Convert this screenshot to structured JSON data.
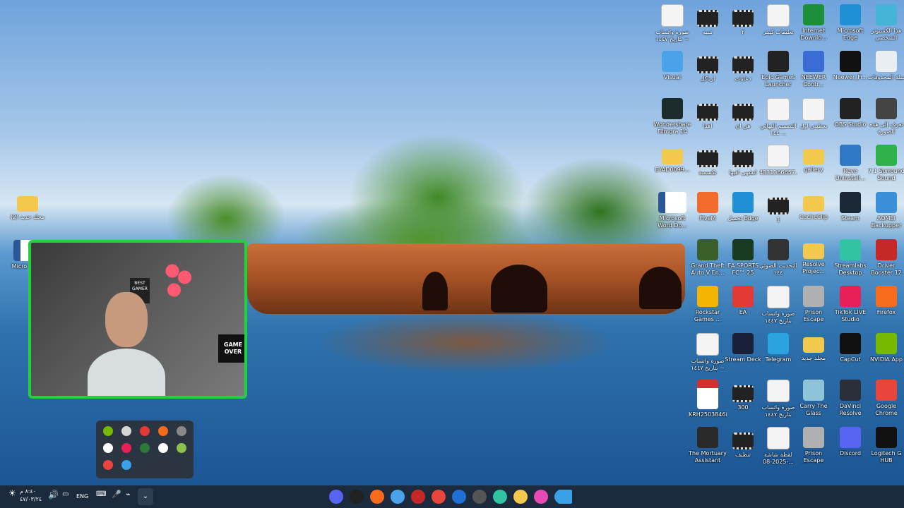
{
  "desktop": {
    "icons": [
      {
        "label": "صورة واتساب بتاريخ ١٤٤٧ ~",
        "kind": "doc",
        "color": "#f4f4f4"
      },
      {
        "label": "تنبيه",
        "kind": "video",
        "color": "#222"
      },
      {
        "label": "٢",
        "kind": "video",
        "color": "#222"
      },
      {
        "label": "تعليقات كيبتر",
        "kind": "doc",
        "color": "#f4f4f4"
      },
      {
        "label": "Internet Downlo...",
        "kind": "app",
        "color": "#1c8f3a"
      },
      {
        "label": "Microsoft Edge",
        "kind": "app",
        "color": "#1f8fd6"
      },
      {
        "label": "هذا الكمبيوتر الشخصي",
        "kind": "app",
        "color": "#44b5d6"
      },
      {
        "label": "Visual",
        "kind": "app",
        "color": "#4aa3e8"
      },
      {
        "label": "ارباكل",
        "kind": "video",
        "color": "#222"
      },
      {
        "label": "دعايات",
        "kind": "video",
        "color": "#222"
      },
      {
        "label": "Epic Games Launcher",
        "kind": "app",
        "color": "#222"
      },
      {
        "label": "NEEWER Contr...",
        "kind": "app",
        "color": "#3a6cd6"
      },
      {
        "label": "Neewer_Fi...",
        "kind": "app",
        "color": "#111"
      },
      {
        "label": "سلة المحذوفات",
        "kind": "app",
        "color": "#e8eef2"
      },
      {
        "label": "Wondershare Filmora 14",
        "kind": "app",
        "color": "#1c2b2b"
      },
      {
        "label": "اهدا",
        "kind": "video",
        "color": "#222"
      },
      {
        "label": "هن ان",
        "kind": "video",
        "color": "#222"
      },
      {
        "label": "التصميم النهائي ١٤٤ ...",
        "kind": "doc",
        "color": "#f4f4f4"
      },
      {
        "label": "بعطيني اول",
        "kind": "doc",
        "color": "#e0e0e0"
      },
      {
        "label": "OBS Studio",
        "kind": "app",
        "color": "#222"
      },
      {
        "label": "تعرف إلى هذه الصورة",
        "kind": "app",
        "color": "#444"
      },
      {
        "label": "EYAD0099...",
        "kind": "folder",
        "color": "#f2c94c"
      },
      {
        "label": "تكسسة",
        "kind": "video",
        "color": "#222"
      },
      {
        "label": "اتشهي افيها",
        "kind": "video",
        "color": "#222"
      },
      {
        "label": "4331366657...",
        "kind": "doc",
        "color": "#9bd06a"
      },
      {
        "label": "gallery",
        "kind": "folder",
        "color": "#f2c94c"
      },
      {
        "label": "Revo Uninstall...",
        "kind": "app",
        "color": "#2f79c7"
      },
      {
        "label": "7.1 Surround Sound",
        "kind": "app",
        "color": "#2fb24a"
      },
      {
        "label": "Microsoft Word Do...",
        "kind": "word",
        "color": "#2b5797"
      },
      {
        "label": "FiveM",
        "kind": "app",
        "color": "#f26b2a"
      },
      {
        "label": "تحميل Edge",
        "kind": "app",
        "color": "#1f8fd6"
      },
      {
        "label": "1",
        "kind": "video",
        "color": "#222"
      },
      {
        "label": "CacheClip",
        "kind": "folder",
        "color": "#f2c94c"
      },
      {
        "label": "Steam",
        "kind": "app",
        "color": "#1b2838"
      },
      {
        "label": "AOMEI Backupper",
        "kind": "app",
        "color": "#3a8fd8"
      },
      {
        "label": "Grand Theft Auto V En...",
        "kind": "app",
        "color": "#3b5f2a"
      },
      {
        "label": "EA SPORTS FC™ 25",
        "kind": "app",
        "color": "#173a20"
      },
      {
        "label": "التحديث الضوئي ١٤٤",
        "kind": "app",
        "color": "#333"
      },
      {
        "label": "Resolve Projec...",
        "kind": "folder",
        "color": "#f2c94c"
      },
      {
        "label": "Streamlabs Desktop",
        "kind": "app",
        "color": "#31c3a2"
      },
      {
        "label": "Driver Booster 12",
        "kind": "app",
        "color": "#c62828"
      },
      {
        "label": "Rockstar Games ...",
        "kind": "app",
        "color": "#f4b400"
      },
      {
        "label": "EA",
        "kind": "app",
        "color": "#e53935"
      },
      {
        "label": "صورة واتساب بتاريخ ١٤٤٧",
        "kind": "doc",
        "color": "#444"
      },
      {
        "label": "Prison Escape Simulator D...",
        "kind": "app",
        "color": "#b0b0b0"
      },
      {
        "label": "TikTok LIVE Studio",
        "kind": "app",
        "color": "#e8205a"
      },
      {
        "label": "Firefox",
        "kind": "app",
        "color": "#f76b1c"
      },
      {
        "label": "صورة واتساب بتاريخ ١٤٤٧ ~",
        "kind": "doc",
        "color": "#e8eef2"
      },
      {
        "label": "Stream Deck",
        "kind": "app",
        "color": "#1a1f3a"
      },
      {
        "label": "Telegram",
        "kind": "app",
        "color": "#2aa3df"
      },
      {
        "label": "مجلد جديد",
        "kind": "folder",
        "color": "#f2c94c"
      },
      {
        "label": "CapCut",
        "kind": "app",
        "color": "#111"
      },
      {
        "label": "NVIDIA App",
        "kind": "app",
        "color": "#76b900"
      },
      {
        "label": "KRH25038468",
        "kind": "pdf",
        "color": "#d32f2f"
      },
      {
        "label": "300",
        "kind": "video",
        "color": "#222"
      },
      {
        "label": "صورة واتساب بتاريخ ١٤٤٧",
        "kind": "doc",
        "color": "#444"
      },
      {
        "label": "Carry The Glass",
        "kind": "app",
        "color": "#8fc3d8"
      },
      {
        "label": "DaVinci Resolve",
        "kind": "app",
        "color": "#2a2f38"
      },
      {
        "label": "Google Chrome",
        "kind": "app",
        "color": "#e8453c"
      },
      {
        "label": "The Mortuary Assistant",
        "kind": "app",
        "color": "#2a2a2a"
      },
      {
        "label": "تنظيف",
        "kind": "video",
        "color": "#222"
      },
      {
        "label": "لقطة شاشة 2025-08-...",
        "kind": "doc",
        "color": "#7fae5a"
      },
      {
        "label": "Prison Escape Simulator D...",
        "kind": "app",
        "color": "#b0b0b0"
      },
      {
        "label": "Discord",
        "kind": "app",
        "color": "#5865f2"
      },
      {
        "label": "Logitech G HUB",
        "kind": "app",
        "color": "#111"
      },
      {
        "label": "مجلد جديد (2)",
        "kind": "folder",
        "color": "#f2c94c"
      },
      {
        "label": "Micro Word",
        "kind": "word",
        "color": "#2b5797"
      }
    ]
  },
  "webcam": {
    "poster_text": "GAME OVER",
    "sign_text": "BEST GAMER"
  },
  "tray_overflow": {
    "icons": [
      "#76b900",
      "#d6d6d6",
      "#e53935",
      "#f76b1c",
      "#888",
      "#ffffff",
      "#e8205a",
      "#2a7a3a",
      "#ffffff",
      "#8bc34a",
      "#e8453c",
      "#3aa0e8"
    ]
  },
  "taskbar": {
    "language": "ENG",
    "time": "٨:٤٠ م",
    "date": "٤٧/٠٣/٢٤",
    "apps": [
      "#5865f2",
      "#222",
      "#f76b1c",
      "#4aa3e8",
      "#c62828",
      "#e8453c",
      "#1f6fd6",
      "#555",
      "#31c3a2",
      "#f2c94c",
      "#e84ab5",
      "#3aa0e8"
    ]
  }
}
